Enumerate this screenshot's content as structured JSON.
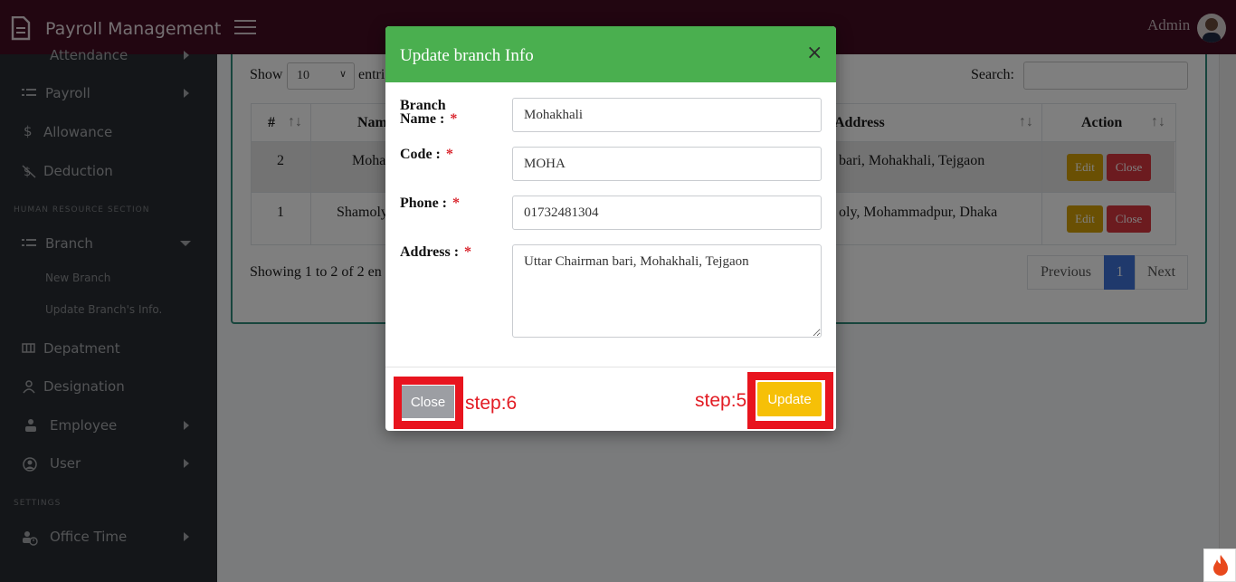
{
  "app": {
    "title": "Payroll Management",
    "user": "Admin"
  },
  "sidebar": {
    "items_top": [
      {
        "label": "Attendance"
      },
      {
        "label": "Payroll"
      },
      {
        "label": "Allowance"
      },
      {
        "label": "Deduction"
      }
    ],
    "section_hr": "HUMAN RESOURCE SECTION",
    "branch": {
      "label": "Branch",
      "sub": [
        "New Branch",
        "Update Branch's Info."
      ]
    },
    "items_hr": [
      {
        "label": "Depatment"
      },
      {
        "label": "Designation"
      },
      {
        "label": "Employee"
      },
      {
        "label": "User"
      }
    ],
    "section_settings": "SETTINGS",
    "office_time": "Office Time"
  },
  "table_bg": {
    "show": "Show",
    "page_size": "10",
    "entries": "entri",
    "search_label": "Search:",
    "col_hash": "#",
    "col_name": "Nam",
    "col_address": "Address",
    "col_action": "Action",
    "rows": [
      {
        "num": "2",
        "name": "Moha",
        "address": "bari, Mohakhali, Tejgaon"
      },
      {
        "num": "1",
        "name": "Shamoly",
        "address": "oly, Mohammadpur, Dhaka"
      }
    ],
    "edit": "Edit",
    "close": "Close",
    "showing": "Showing 1 to 2 of 2 en",
    "prev": "Previous",
    "page": "1",
    "next": "Next"
  },
  "modal": {
    "title": "Update branch Info",
    "close_x": "×",
    "fields": {
      "name_label_1": "Branch",
      "name_label_2": "Name :",
      "name_value": "Mohakhali",
      "code_label": "Code :",
      "code_value": "MOHA",
      "phone_label": "Phone :",
      "phone_value": "01732481304",
      "address_label": "Address :",
      "address_value": "Uttar Chairman bari, Mohakhali, Tejgaon",
      "required": "*"
    },
    "close_button": "Close",
    "update_button": "Update",
    "step6": "step:6",
    "step5": "step:5"
  },
  "colors": {
    "topbar": "#450d22",
    "sidebar": "#282d33",
    "modal_header": "#4aaf4f",
    "update_button": "#f6c007",
    "highlight": "#e8141e",
    "edit_button": "#d4a006",
    "close_button_red": "#d9373f",
    "pager_active": "#3f72d9"
  },
  "icons": [
    "document-icon",
    "hamburger-icon",
    "avatar",
    "caret-right-icon",
    "caret-down-icon",
    "list-icon",
    "dollar-icon",
    "deduction-icon",
    "columns-icon",
    "person-icon",
    "users-icon",
    "user-cog-icon",
    "clock-user-icon",
    "sort-icon",
    "close-icon",
    "resize-handle-icon",
    "flame-icon"
  ]
}
